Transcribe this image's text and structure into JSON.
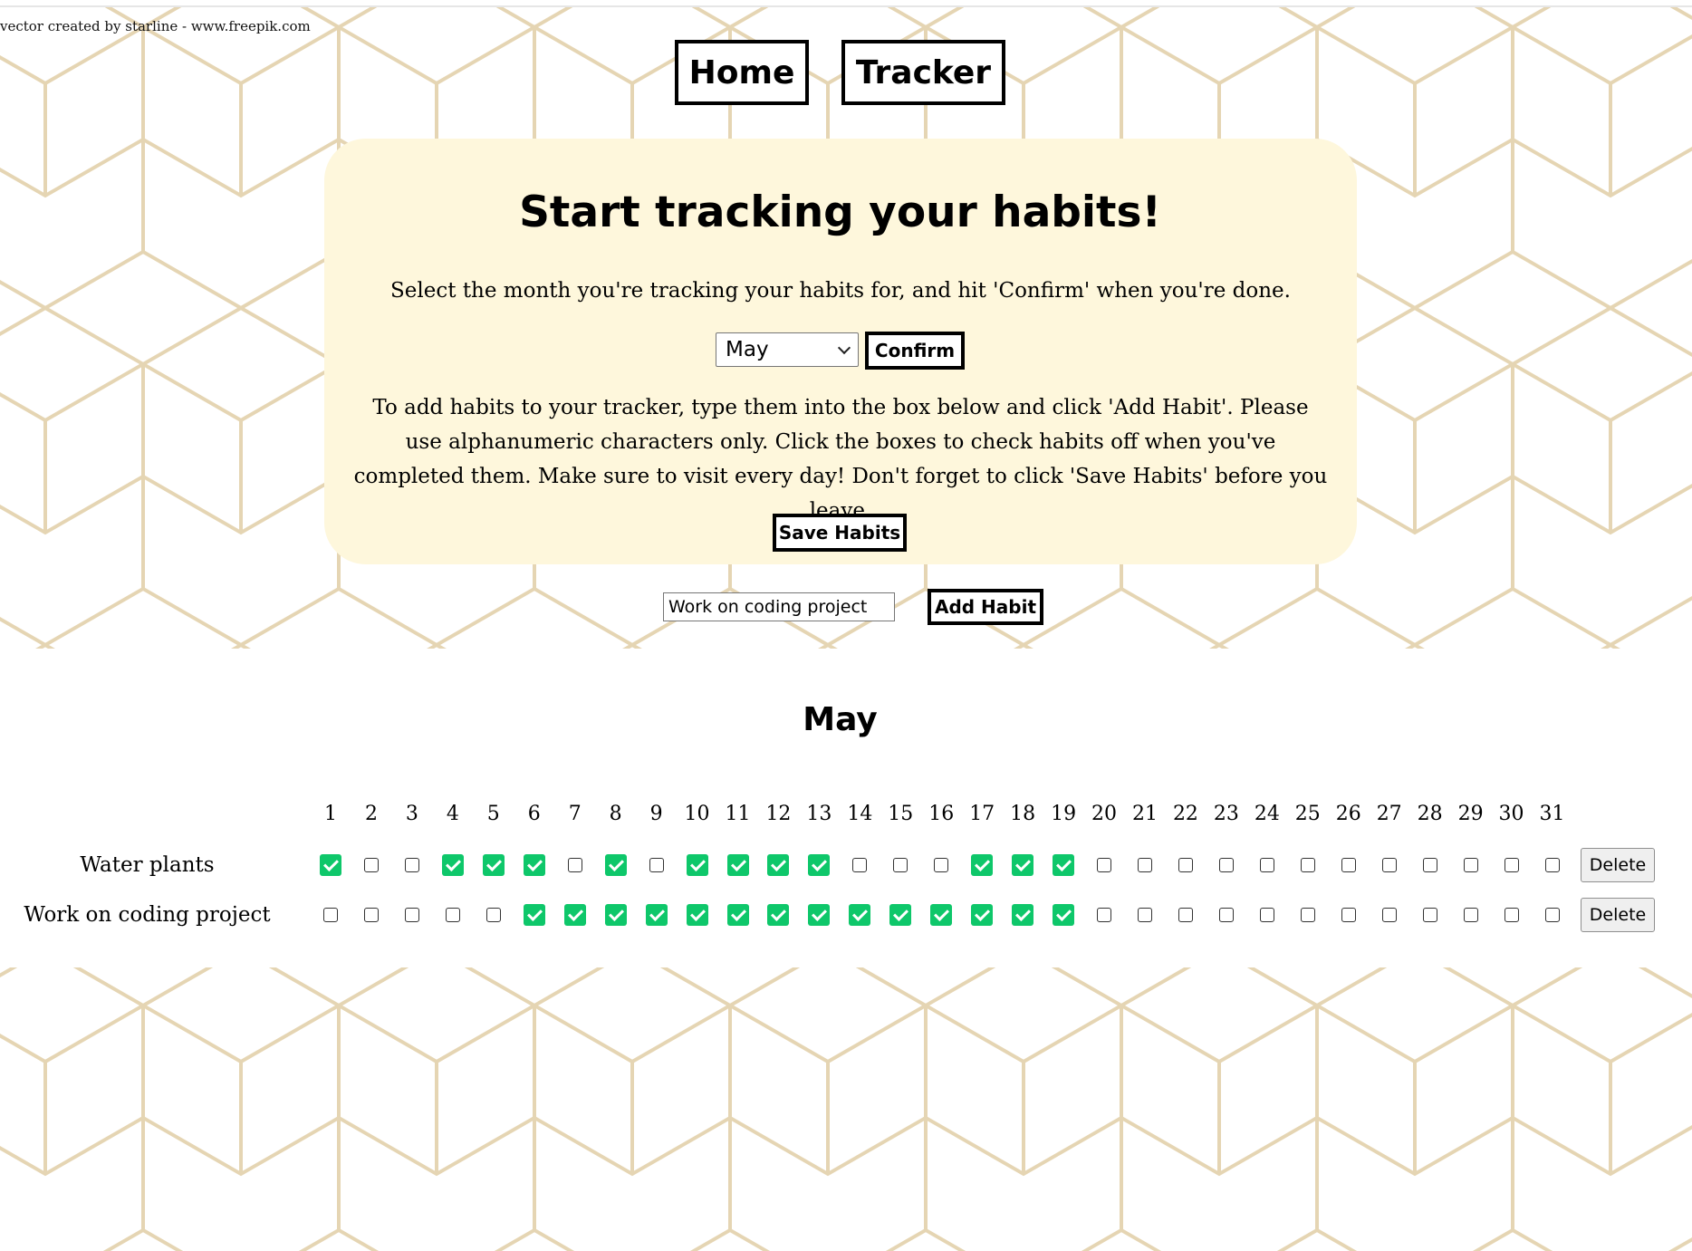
{
  "credit": "vector created by starline - www.freepik.com",
  "nav": {
    "home_label": "Home",
    "tracker_label": "Tracker"
  },
  "panel": {
    "title": "Start tracking your habits!",
    "intro": "Select the month you're tracking your habits for, and hit 'Confirm' when you're done.",
    "selected_month": "May",
    "confirm_label": "Confirm",
    "instructions": "To add habits to your tracker, type them into the box below and click 'Add Habit'. Please use alphanumeric characters only. Click the boxes to check habits off when you've completed them. Make sure to visit every day! Don't forget to click 'Save Habits' before you leave.",
    "save_label": "Save Habits"
  },
  "add_habit": {
    "input_value": "Work on coding project",
    "button_label": "Add Habit"
  },
  "tracker": {
    "month_title": "May",
    "days": [
      "1",
      "2",
      "3",
      "4",
      "5",
      "6",
      "7",
      "8",
      "9",
      "10",
      "11",
      "12",
      "13",
      "14",
      "15",
      "16",
      "17",
      "18",
      "19",
      "20",
      "21",
      "22",
      "23",
      "24",
      "25",
      "26",
      "27",
      "28",
      "29",
      "30",
      "31"
    ],
    "delete_label": "Delete",
    "habits": [
      {
        "name": "Water plants",
        "checked": [
          1,
          0,
          0,
          1,
          1,
          1,
          0,
          1,
          0,
          1,
          1,
          1,
          1,
          0,
          0,
          0,
          1,
          1,
          1,
          0,
          0,
          0,
          0,
          0,
          0,
          0,
          0,
          0,
          0,
          0,
          0
        ]
      },
      {
        "name": "Work on coding project",
        "checked": [
          0,
          0,
          0,
          0,
          0,
          1,
          1,
          1,
          1,
          1,
          1,
          1,
          1,
          1,
          1,
          1,
          1,
          1,
          1,
          0,
          0,
          0,
          0,
          0,
          0,
          0,
          0,
          0,
          0,
          0,
          0
        ]
      }
    ]
  },
  "colors": {
    "panel_bg": "#fef7dc",
    "pattern_stroke": "#e5d5b3",
    "check_green": "#0ec76a"
  }
}
